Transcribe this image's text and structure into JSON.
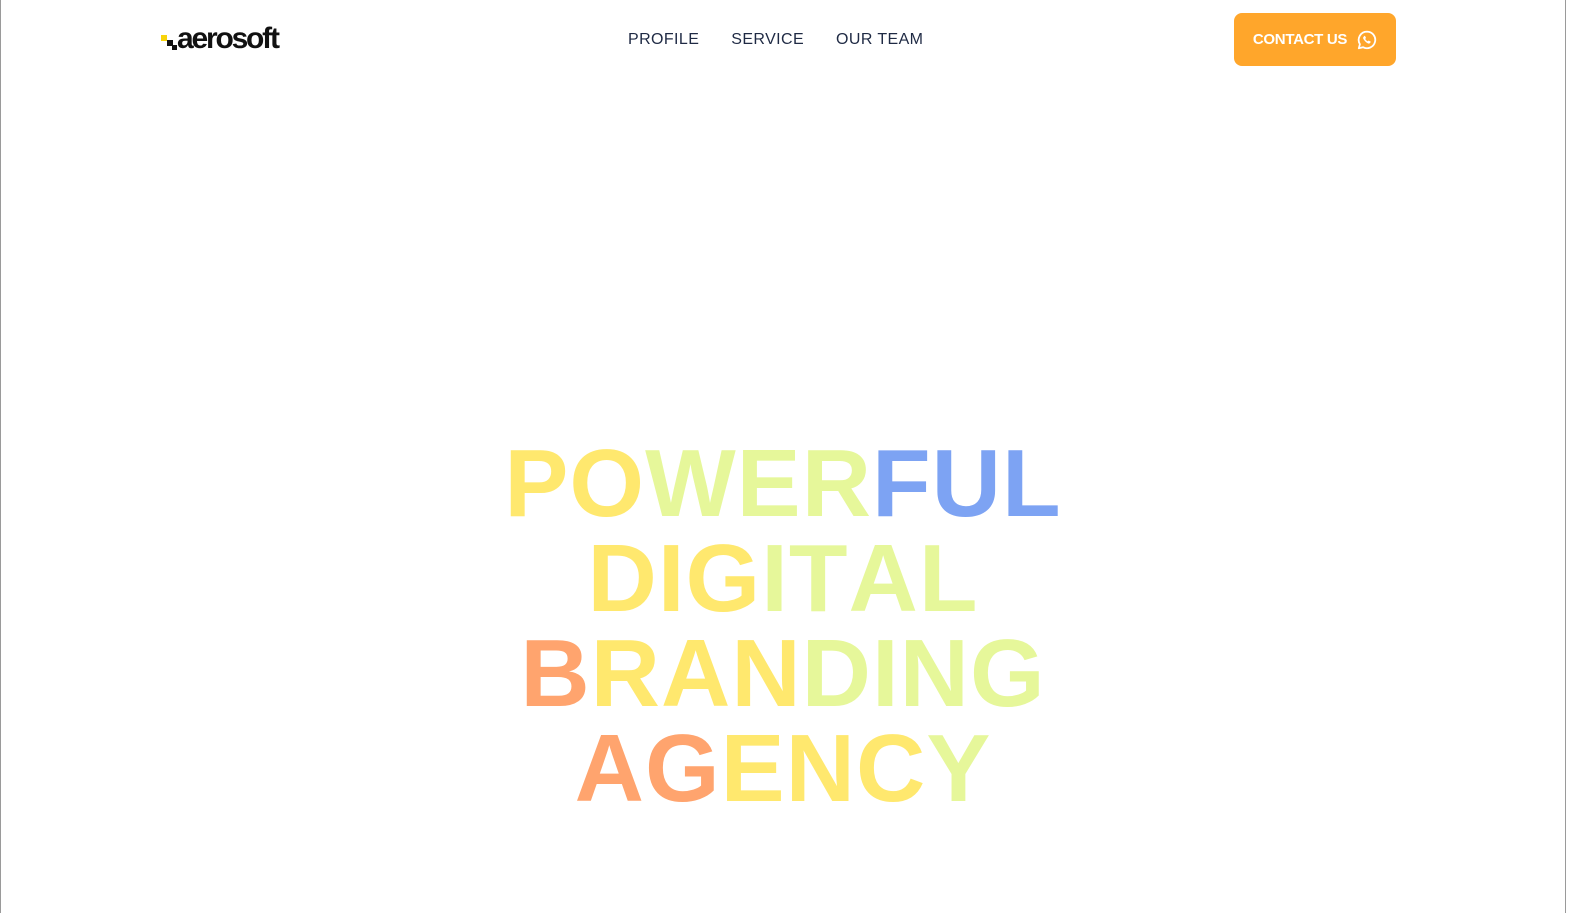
{
  "brand": {
    "name": "aerosoft",
    "colors": {
      "accent": "#ffa62b",
      "logo_dot": "#f8d40a",
      "nav_text": "#1f2a44"
    }
  },
  "nav": {
    "items": [
      {
        "label": "PROFILE"
      },
      {
        "label": "SERVICE"
      },
      {
        "label": "OUR TEAM"
      }
    ]
  },
  "cta": {
    "label": "CONTACT US",
    "icon": "whatsapp-icon"
  },
  "hero": {
    "lines": [
      {
        "text": "POWERFUL",
        "colors": [
          "#ffe86e",
          "#ffe86e",
          "#e6f79a",
          "#e6f79a",
          "#e6f79a",
          "#7da3f3",
          "#7da3f3",
          "#7da3f3"
        ]
      },
      {
        "text": "DIGITAL",
        "colors": [
          "#ffe86e",
          "#ffe86e",
          "#ffe86e",
          "#e6f79a",
          "#e6f79a",
          "#e6f79a",
          "#e6f79a"
        ]
      },
      {
        "text": "BRANDING",
        "colors": [
          "#ffa46e",
          "#ffe86e",
          "#ffe86e",
          "#ffe86e",
          "#e6f79a",
          "#e6f79a",
          "#e6f79a",
          "#e6f79a"
        ]
      },
      {
        "text": "AGENCY",
        "colors": [
          "#ffa46e",
          "#ffa46e",
          "#ffe86e",
          "#ffe86e",
          "#ffe86e",
          "#e6f79a"
        ]
      }
    ]
  }
}
